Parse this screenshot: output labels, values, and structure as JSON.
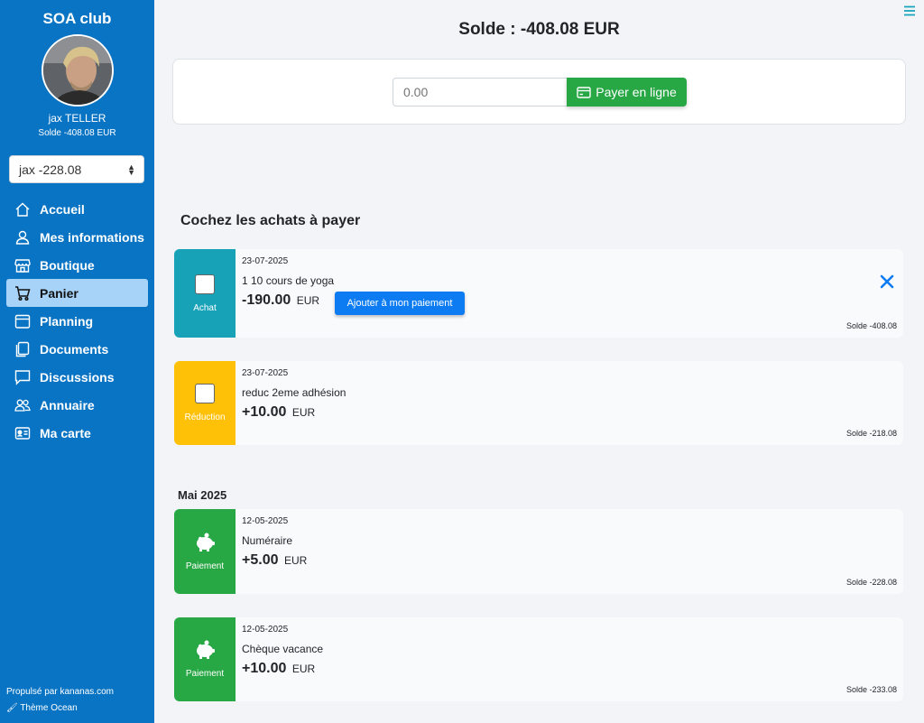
{
  "sidebar": {
    "club_name": "SOA club",
    "user_name": "jax TELLER",
    "solde_label": "Solde",
    "solde_value": "-408.08 EUR",
    "account_select": "jax -228.08",
    "items": [
      {
        "label": "Accueil",
        "icon": "home-icon",
        "active": false
      },
      {
        "label": "Mes informations",
        "icon": "user-icon",
        "active": false
      },
      {
        "label": "Boutique",
        "icon": "shop-icon",
        "active": false
      },
      {
        "label": "Panier",
        "icon": "cart-icon",
        "active": true
      },
      {
        "label": "Planning",
        "icon": "calendar-icon",
        "active": false
      },
      {
        "label": "Documents",
        "icon": "documents-icon",
        "active": false
      },
      {
        "label": "Discussions",
        "icon": "chat-icon",
        "active": false
      },
      {
        "label": "Annuaire",
        "icon": "people-icon",
        "active": false
      },
      {
        "label": "Ma carte",
        "icon": "id-card-icon",
        "active": false
      }
    ],
    "footer_powered": "Propulsé par kananas.com",
    "footer_theme": "Thème Ocean"
  },
  "main": {
    "title": "Solde : -408.08 EUR",
    "payment": {
      "amount_value": "",
      "amount_placeholder": "0.00",
      "button_label": "Payer en ligne"
    },
    "section_title": "Cochez les achats à payer",
    "pending": [
      {
        "type": "Achat",
        "color": "#17a2b8",
        "date": "23-07-2025",
        "label": "1 10 cours de yoga",
        "amount": "-190.00",
        "currency": "EUR",
        "solde": "Solde -408.08",
        "add_label": "Ajouter à mon paiement"
      },
      {
        "type": "Réduction",
        "color": "#ffc107",
        "date": "23-07-2025",
        "label": "reduc 2eme adhésion",
        "amount": "+10.00",
        "currency": "EUR",
        "solde": "Solde -218.08"
      }
    ],
    "month_label": "Mai 2025",
    "payments": [
      {
        "type": "Paiement",
        "color": "#28a745",
        "date": "12-05-2025",
        "label": "Numéraire",
        "amount": "+5.00",
        "currency": "EUR",
        "solde": "Solde -228.08"
      },
      {
        "type": "Paiement",
        "color": "#28a745",
        "date": "12-05-2025",
        "label": "Chèque vacance",
        "amount": "+10.00",
        "currency": "EUR",
        "solde": "Solde -233.08"
      }
    ]
  },
  "colors": {
    "sidebar_bg": "#0a74c4",
    "active_item_bg": "#a7d3f8",
    "achat": "#17a2b8",
    "reduction": "#ffc107",
    "paiement": "#28a745",
    "add_button": "#0d7cf2"
  }
}
